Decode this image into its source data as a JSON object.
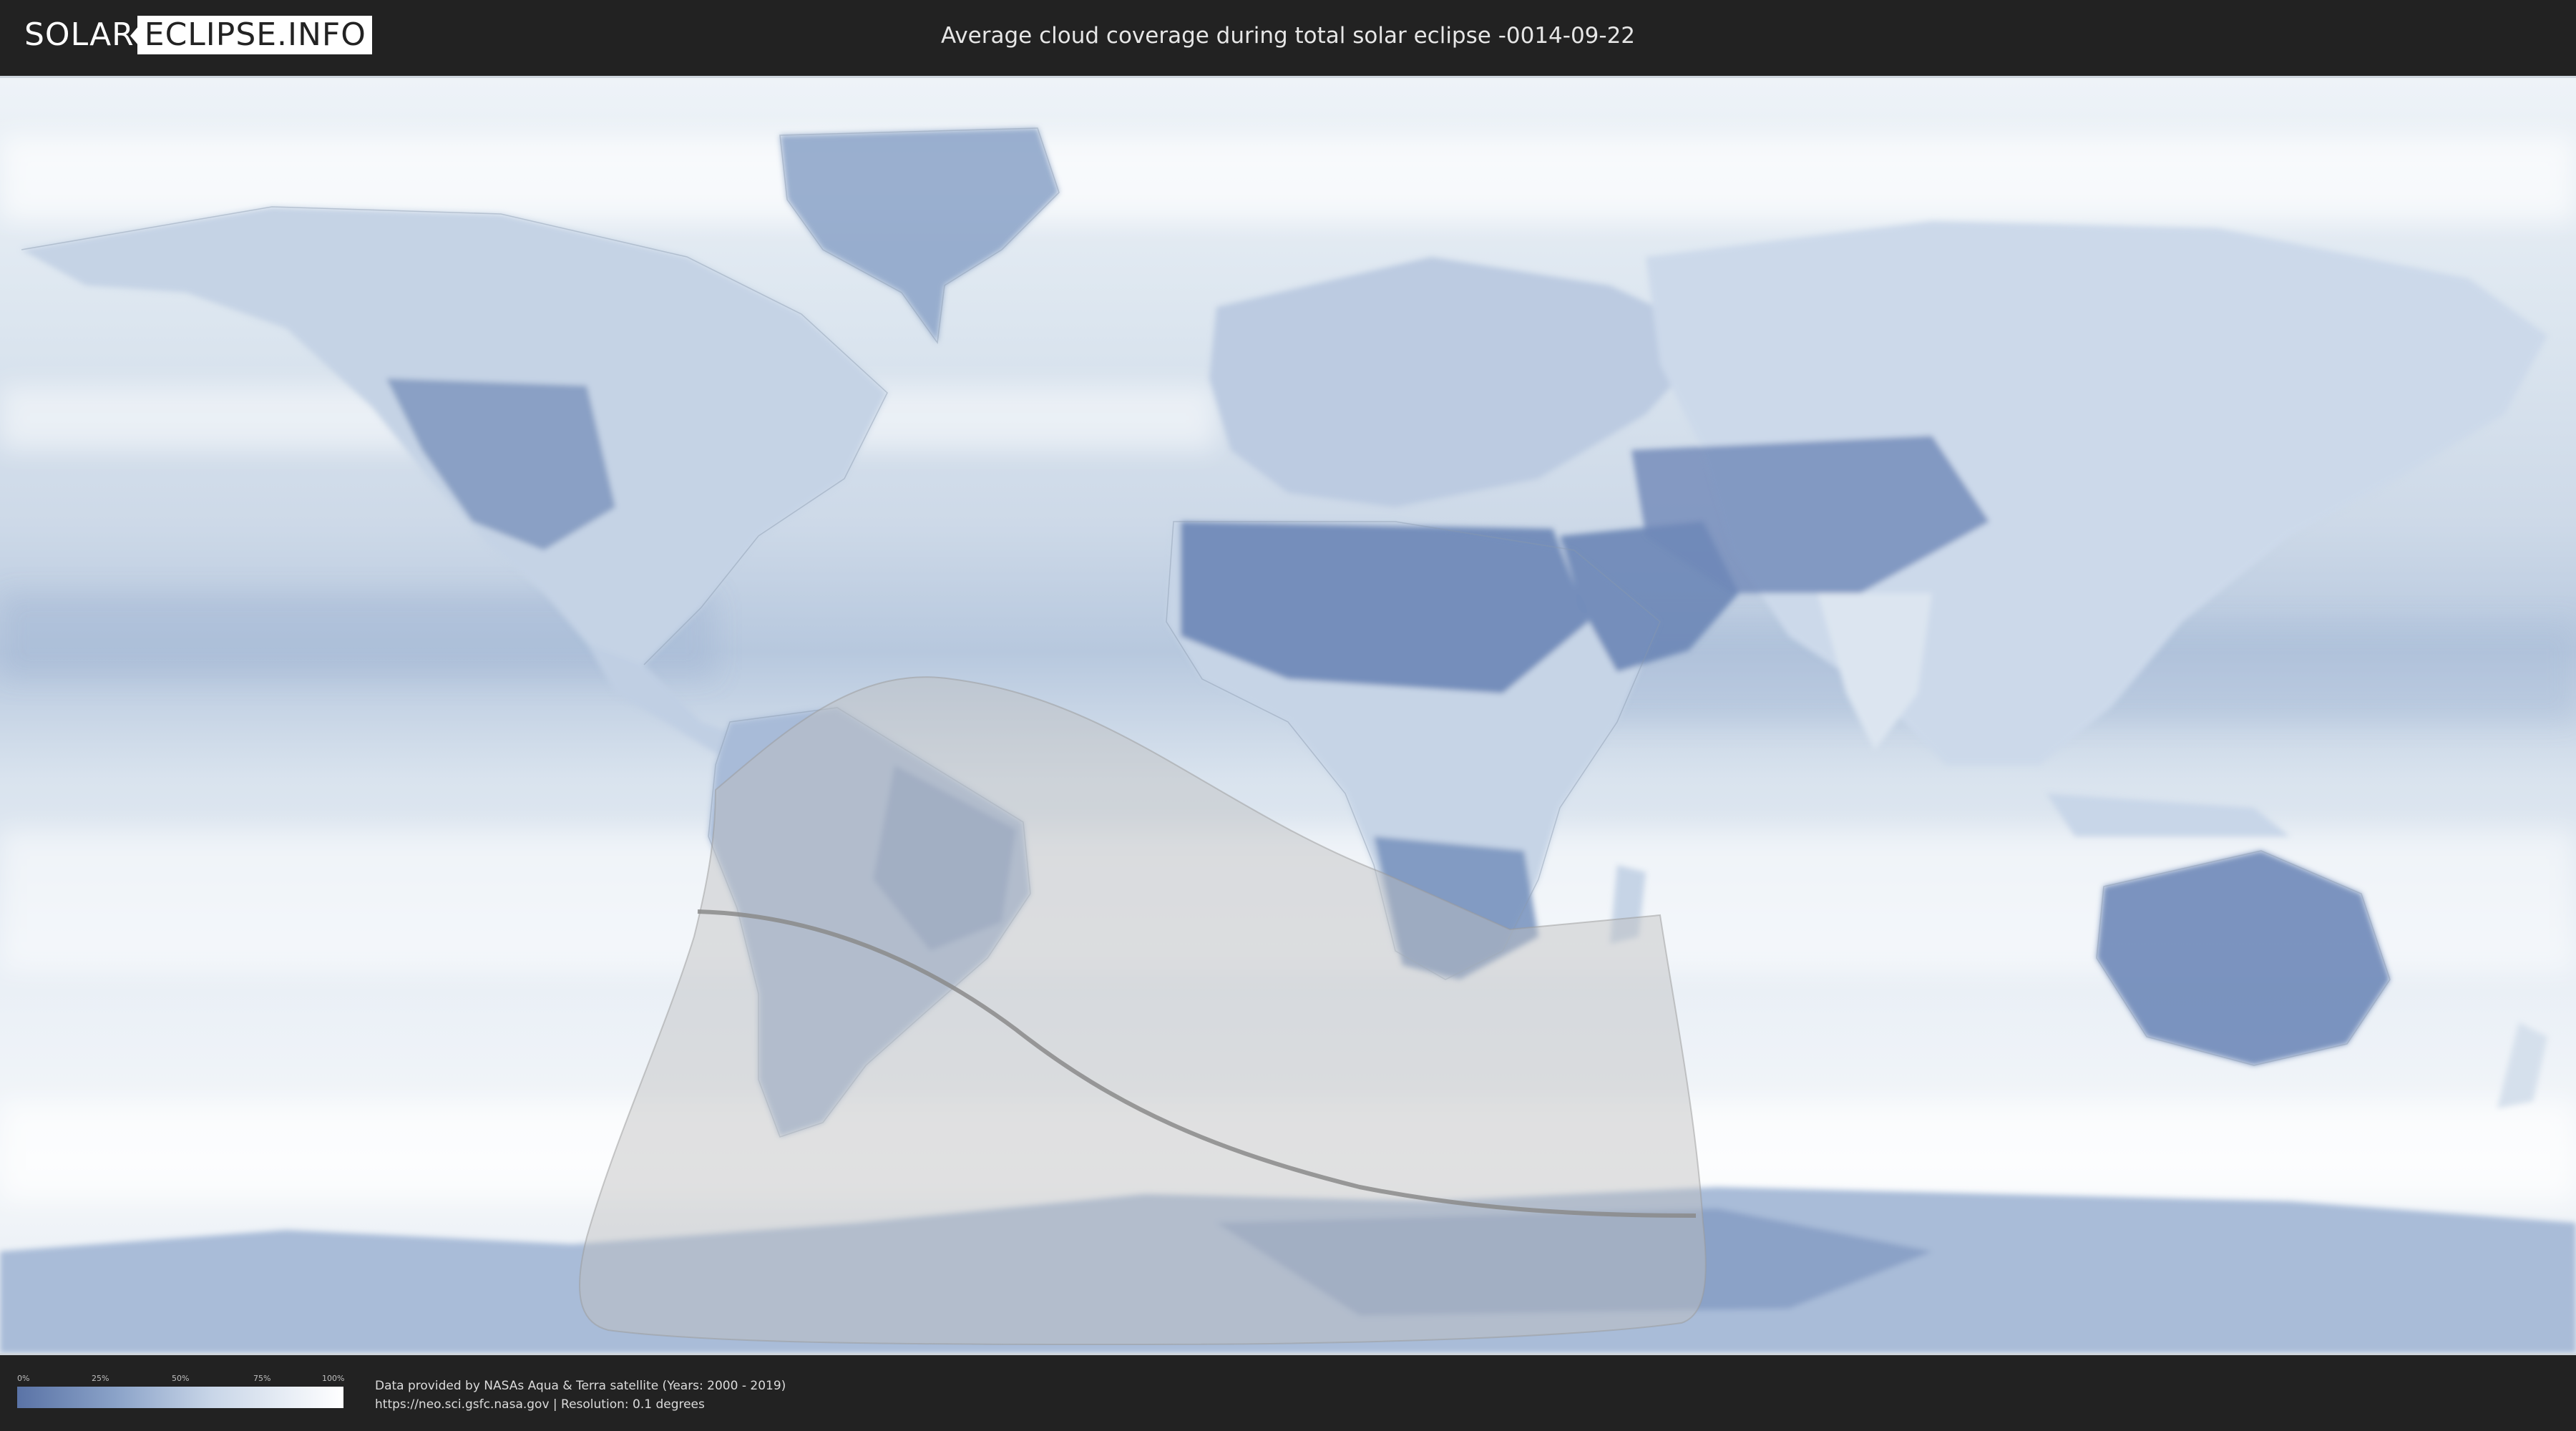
{
  "header": {
    "logo_left": "SOLAR",
    "logo_right": "ECLIPSE.INFO",
    "title": "Average cloud coverage during total solar eclipse -0014-09-22"
  },
  "legend": {
    "ticks": [
      "0%",
      "25%",
      "50%",
      "75%",
      "100%"
    ],
    "gradient": [
      "#5a73a6",
      "#8aa2c8",
      "#c9d6e8",
      "#ffffff"
    ]
  },
  "credits": {
    "line1": "Data provided by NASAs Aqua & Terra satellite (Years: 2000 - 2019)",
    "line2": "https://neo.sci.gsfc.nasa.gov | Resolution: 0.1 degrees"
  },
  "colors": {
    "background": "#222222",
    "cloud_white": "#f2f6fa",
    "clear_blue": "#6f88b8",
    "eclipse_overlay": "#bfbfbf",
    "central_line": "#8a8a8a"
  }
}
